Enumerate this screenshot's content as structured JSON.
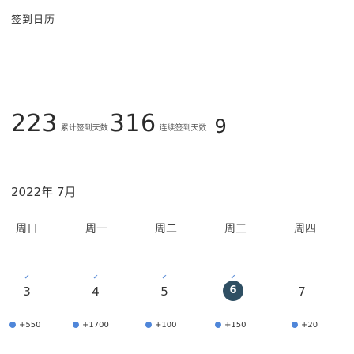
{
  "header": {
    "title": "签到日历"
  },
  "stats": [
    {
      "value": "223",
      "label": "累计签到天数"
    },
    {
      "value": "316",
      "label": "连续签到天数"
    },
    {
      "value": "9",
      "label": ""
    }
  ],
  "calendar": {
    "month_title": "2022年 7月",
    "weekdays": [
      "周日",
      "周一",
      "周二",
      "周三",
      "周四"
    ],
    "days": [
      {
        "num": "3",
        "checked": true,
        "current": false
      },
      {
        "num": "4",
        "checked": true,
        "current": false
      },
      {
        "num": "5",
        "checked": true,
        "current": false
      },
      {
        "num": "6",
        "checked": true,
        "current": true
      },
      {
        "num": "7",
        "checked": false,
        "current": false
      }
    ],
    "rewards": [
      "+550",
      "+1700",
      "+100",
      "+150",
      "+20"
    ],
    "check_symbol": "✔"
  },
  "colors": {
    "accent": "#4f86d9",
    "current_day_bg": "#2f4f63",
    "text": "#333333"
  }
}
